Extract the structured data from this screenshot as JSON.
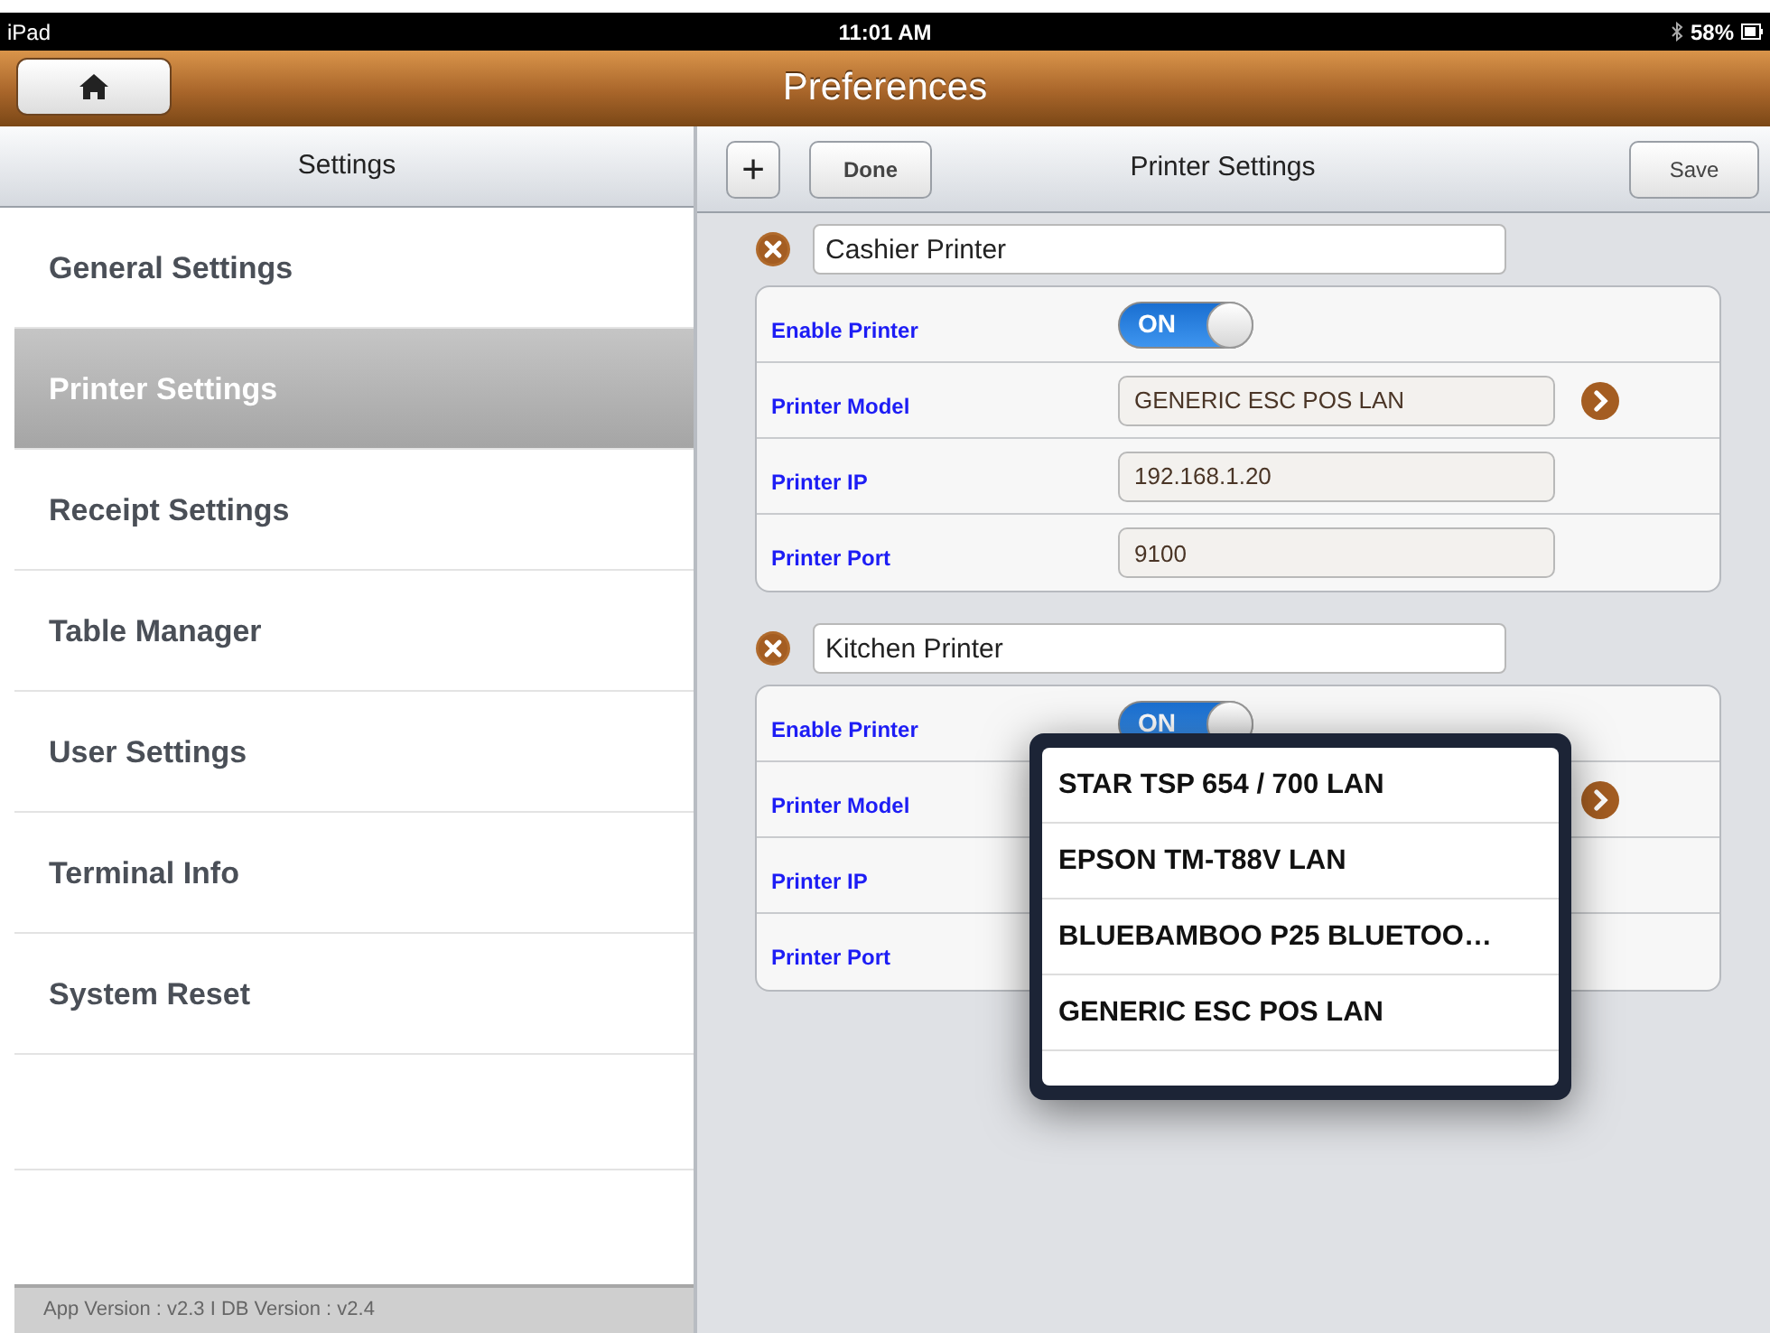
{
  "status_bar": {
    "device": "iPad",
    "time": "11:01 AM",
    "battery": "58%"
  },
  "nav_bar": {
    "title": "Preferences"
  },
  "sidebar": {
    "title": "Settings",
    "items": [
      {
        "label": "General Settings",
        "selected": false
      },
      {
        "label": "Printer Settings",
        "selected": true
      },
      {
        "label": "Receipt Settings",
        "selected": false
      },
      {
        "label": "Table Manager",
        "selected": false
      },
      {
        "label": "User Settings",
        "selected": false
      },
      {
        "label": "Terminal Info",
        "selected": false
      },
      {
        "label": "System Reset",
        "selected": false
      }
    ],
    "footer": "App Version : v2.3  I  DB Version : v2.4"
  },
  "detail": {
    "toolbar": {
      "add_button": "+",
      "done_button": "Done",
      "title": "Printer Settings",
      "save_button": "Save"
    },
    "printers": [
      {
        "name": "Cashier Printer",
        "fields": [
          {
            "kind": "toggle",
            "label": "Enable Printer",
            "on": true,
            "toggle_text": "ON"
          },
          {
            "kind": "picker",
            "label": "Printer Model",
            "value": "GENERIC ESC POS LAN"
          },
          {
            "kind": "text",
            "label": "Printer IP",
            "value": "192.168.1.20"
          },
          {
            "kind": "text",
            "label": "Printer Port",
            "value": "9100"
          }
        ]
      },
      {
        "name": "Kitchen Printer",
        "fields": [
          {
            "kind": "toggle",
            "label": "Enable Printer",
            "on": true,
            "toggle_text": "ON"
          },
          {
            "kind": "picker",
            "label": "Printer Model"
          },
          {
            "kind": "text",
            "label": "Printer IP"
          },
          {
            "kind": "text",
            "label": "Printer Port"
          }
        ]
      }
    ]
  },
  "popover": {
    "options": [
      "STAR TSP 654 / 700 LAN",
      "EPSON TM-T88V LAN",
      "BLUEBAMBOO P25 BLUETOO…",
      "GENERIC ESC POS LAN"
    ]
  }
}
